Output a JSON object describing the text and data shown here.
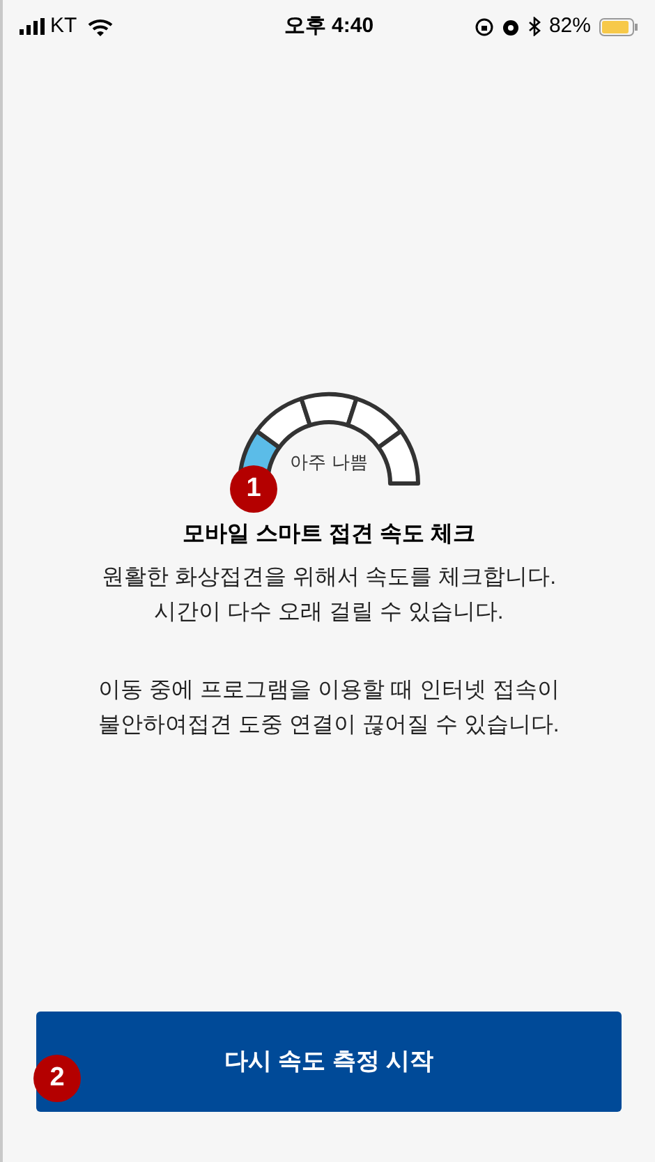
{
  "status_bar": {
    "carrier": "KT",
    "time": "오후 4:40",
    "battery": "82%"
  },
  "gauge": {
    "label": "아주 나쁨",
    "segments": [
      {
        "active": true
      },
      {
        "active": false
      },
      {
        "active": false
      },
      {
        "active": false
      },
      {
        "active": false
      }
    ]
  },
  "title": "모바일 스마트 접견 속도 체크",
  "paragraphs": [
    [
      "원활한 화상접견을 위해서 속도를 체크합니다.",
      "시간이 다수 오래 걸릴 수 있습니다."
    ],
    [
      "이동 중에 프로그램을 이용할 때 인터넷 접속이",
      "불안하여접견 도중 연결이 끊어질 수 있습니다."
    ]
  ],
  "button": "다시 속도 측정 시작",
  "markers": [
    "1",
    "2"
  ]
}
